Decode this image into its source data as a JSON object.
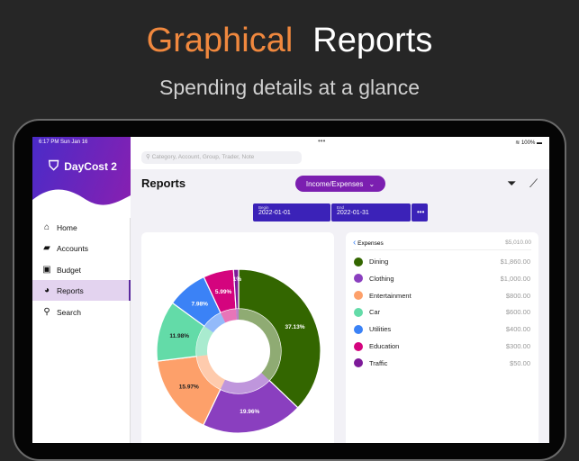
{
  "promo": {
    "title_accent": "Graphical",
    "title_rest": "Reports",
    "subtitle": "Spending details at a glance"
  },
  "status": {
    "time": "6:17 PM  Sun Jan 16",
    "battery": "100%"
  },
  "app": {
    "name": "DayCost 2"
  },
  "sidebar": {
    "items": [
      {
        "label": "Home",
        "icon": "⌂"
      },
      {
        "label": "Accounts",
        "icon": "▰"
      },
      {
        "label": "Budget",
        "icon": "▣"
      },
      {
        "label": "Reports",
        "icon": "◕"
      },
      {
        "label": "Search",
        "icon": "⚲"
      }
    ]
  },
  "search": {
    "placeholder": "Category, Account, Group, Trader, Note"
  },
  "header": {
    "title": "Reports",
    "mode": "Income/Expenses"
  },
  "dates": {
    "begin_label": "Begin",
    "begin": "2022-01-01",
    "end_label": "End",
    "end": "2022-01-31",
    "more": "•••"
  },
  "list": {
    "title": "Expenses",
    "total": "$5,010.00"
  },
  "chart_data": {
    "type": "pie",
    "categories": [
      "Dining",
      "Clothing",
      "Entertainment",
      "Car",
      "Utilities",
      "Education",
      "Traffic"
    ],
    "values": [
      1860,
      1000,
      800,
      600,
      400,
      300,
      50
    ],
    "amounts": [
      "$1,860.00",
      "$1,000.00",
      "$800.00",
      "$600.00",
      "$400.00",
      "$300.00",
      "$50.00"
    ],
    "labels": [
      "37.13%",
      "19.96%",
      "15.97%",
      "11.98%",
      "7.98%",
      "5.99%",
      "1%"
    ],
    "colors": [
      "#336600",
      "#8a3fbf",
      "#fda06a",
      "#63dba8",
      "#3b82f6",
      "#d4047e",
      "#7d1a99"
    ]
  }
}
